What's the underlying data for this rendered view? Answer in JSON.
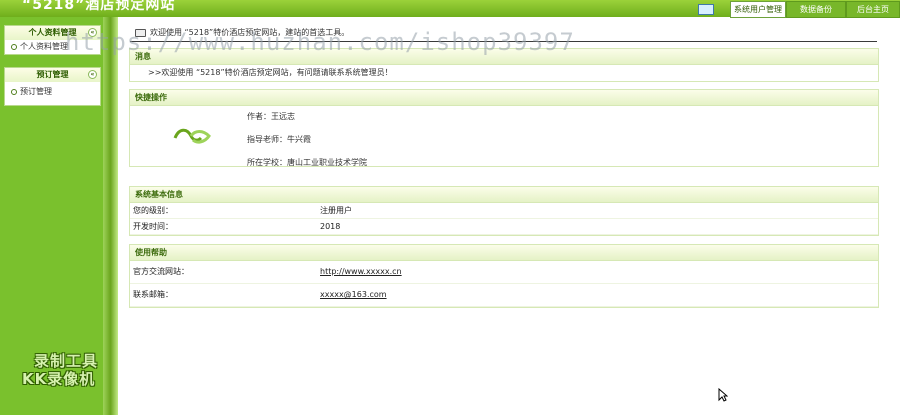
{
  "app_title": "“5218”酒店预定网站",
  "topnav": {
    "user_mgmt": "系统用户管理",
    "backup": "数据备份",
    "home": "后台主页"
  },
  "sidebar": {
    "groups": [
      {
        "title": "个人资料管理",
        "items": [
          {
            "label": "个人资料管理"
          }
        ]
      },
      {
        "title": "预订管理",
        "items": [
          {
            "label": "预订管理"
          }
        ]
      }
    ],
    "badge_line1": "录制工具",
    "badge_line2": "KK录像机"
  },
  "welcome": "欢迎使用 “5218”特价酒店预定网站，建站的首选工具。",
  "watermark": "https://www.huzhan.com/ishop39397",
  "notice": {
    "title": "消息",
    "text": ">>欢迎使用 “5218”特价酒店预定网站，有问题请联系系统管理员！"
  },
  "quick": {
    "title": "快捷操作",
    "author": "作者：王远志",
    "advisor": "指导老师：牛兴霞",
    "school": "所在学校：唐山工业职业技术学院"
  },
  "sysinfo": {
    "title": "系统基本信息",
    "rows": [
      {
        "label": "您的级别：",
        "value": "注册用户"
      },
      {
        "label": "开发时间：",
        "value": "2018"
      }
    ]
  },
  "help": {
    "title": "使用帮助",
    "rows": [
      {
        "label": "官方交流网站：",
        "value": "http://www.xxxxx.cn"
      },
      {
        "label": "联系邮箱：",
        "value": "xxxxx@163.com"
      }
    ]
  }
}
